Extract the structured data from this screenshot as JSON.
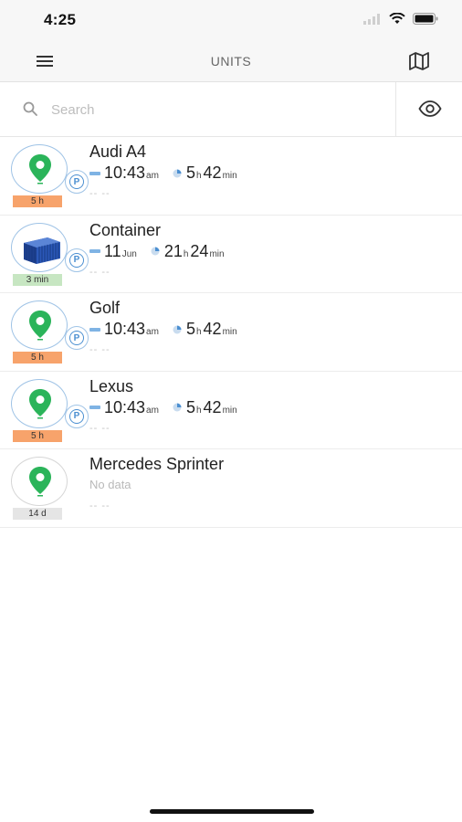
{
  "status_bar": {
    "time": "4:25"
  },
  "nav": {
    "title": "UNITS",
    "menu_icon": "hamburger-menu-icon",
    "map_icon": "map-icon"
  },
  "search": {
    "placeholder": "Search",
    "value": "",
    "visibility_icon": "eye-icon"
  },
  "colors": {
    "pin_green": "#2bb45a",
    "accent_blue": "#4b8fd1",
    "age_orange": "#f7a36b",
    "age_green": "#c7e6c2",
    "age_gray": "#e5e5e5"
  },
  "units": [
    {
      "name": "Audi A4",
      "icon": "map-pin-icon",
      "parked": true,
      "age": "5 h",
      "age_color": "orange",
      "time_value": "10:43",
      "time_unit": "am",
      "dur_h": "5",
      "dur_h_unit": "h",
      "dur_m": "42",
      "dur_m_unit": "min",
      "extra": "-- --"
    },
    {
      "name": "Container",
      "icon": "shipping-container-icon",
      "parked": true,
      "age": "3 min",
      "age_color": "green",
      "time_value": "11",
      "time_unit": "Jun",
      "dur_h": "21",
      "dur_h_unit": "h",
      "dur_m": "24",
      "dur_m_unit": "min",
      "extra": "-- --"
    },
    {
      "name": "Golf",
      "icon": "map-pin-icon",
      "parked": true,
      "age": "5 h",
      "age_color": "orange",
      "time_value": "10:43",
      "time_unit": "am",
      "dur_h": "5",
      "dur_h_unit": "h",
      "dur_m": "42",
      "dur_m_unit": "min",
      "extra": "-- --"
    },
    {
      "name": "Lexus",
      "icon": "map-pin-icon",
      "parked": true,
      "age": "5 h",
      "age_color": "orange",
      "time_value": "10:43",
      "time_unit": "am",
      "dur_h": "5",
      "dur_h_unit": "h",
      "dur_m": "42",
      "dur_m_unit": "min",
      "extra": "-- --"
    },
    {
      "name": "Mercedes Sprinter",
      "icon": "map-pin-icon",
      "parked": false,
      "age": "14 d",
      "age_color": "gray",
      "no_data": "No data",
      "extra": "-- --"
    }
  ]
}
